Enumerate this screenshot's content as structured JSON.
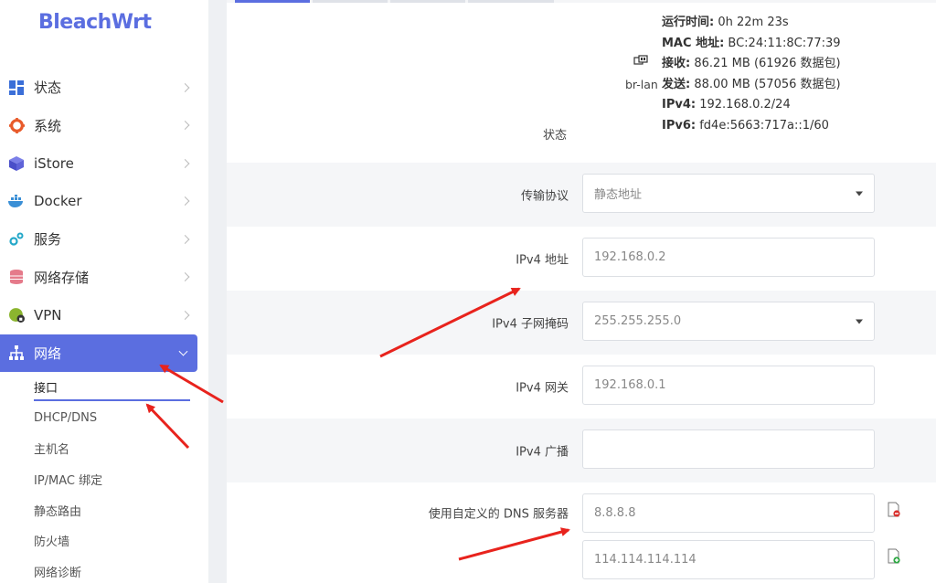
{
  "brand": {
    "logo_text": "BleachWrt",
    "accent": "#5b6ee0"
  },
  "sidebar": {
    "items": [
      {
        "label": "状态",
        "icon": "dashboard-icon"
      },
      {
        "label": "系统",
        "icon": "gear-icon"
      },
      {
        "label": "iStore",
        "icon": "cube-icon"
      },
      {
        "label": "Docker",
        "icon": "docker-whale-icon"
      },
      {
        "label": "服务",
        "icon": "gears-icon"
      },
      {
        "label": "网络存储",
        "icon": "database-icon"
      },
      {
        "label": "VPN",
        "icon": "globe-lock-icon"
      },
      {
        "label": "网络",
        "icon": "network-tree-icon",
        "active": true
      }
    ],
    "subitems": [
      {
        "label": "接口",
        "current": true
      },
      {
        "label": "DHCP/DNS"
      },
      {
        "label": "主机名"
      },
      {
        "label": "IP/MAC 绑定"
      },
      {
        "label": "静态路由"
      },
      {
        "label": "防火墙"
      },
      {
        "label": "网络诊断"
      }
    ]
  },
  "status": {
    "label": "状态",
    "device": "br-lan",
    "lines": [
      {
        "key": "运行时间:",
        "value": " 0h 22m 23s"
      },
      {
        "key": "MAC 地址:",
        "value": " BC:24:11:8C:77:39"
      },
      {
        "key": "接收:",
        "value": " 86.21 MB (61926 数据包)"
      },
      {
        "key": "发送:",
        "value": " 88.00 MB (57056 数据包)"
      },
      {
        "key": "IPv4:",
        "value": " 192.168.0.2/24"
      },
      {
        "key": "IPv6:",
        "value": " fd4e:5663:717a::1/60"
      }
    ]
  },
  "form": {
    "protocol": {
      "label": "传输协议",
      "value": "静态地址"
    },
    "ipv4_addr": {
      "label": "IPv4 地址",
      "value": "192.168.0.2"
    },
    "ipv4_mask": {
      "label": "IPv4 子网掩码",
      "value": "255.255.255.0"
    },
    "ipv4_gw": {
      "label": "IPv4 网关",
      "value": "192.168.0.1"
    },
    "ipv4_bcast": {
      "label": "IPv4 广播",
      "value": ""
    },
    "dns": {
      "label": "使用自定义的 DNS 服务器",
      "values": [
        "8.8.8.8",
        "114.114.114.114"
      ]
    }
  },
  "annotation_color": "#e8231d"
}
